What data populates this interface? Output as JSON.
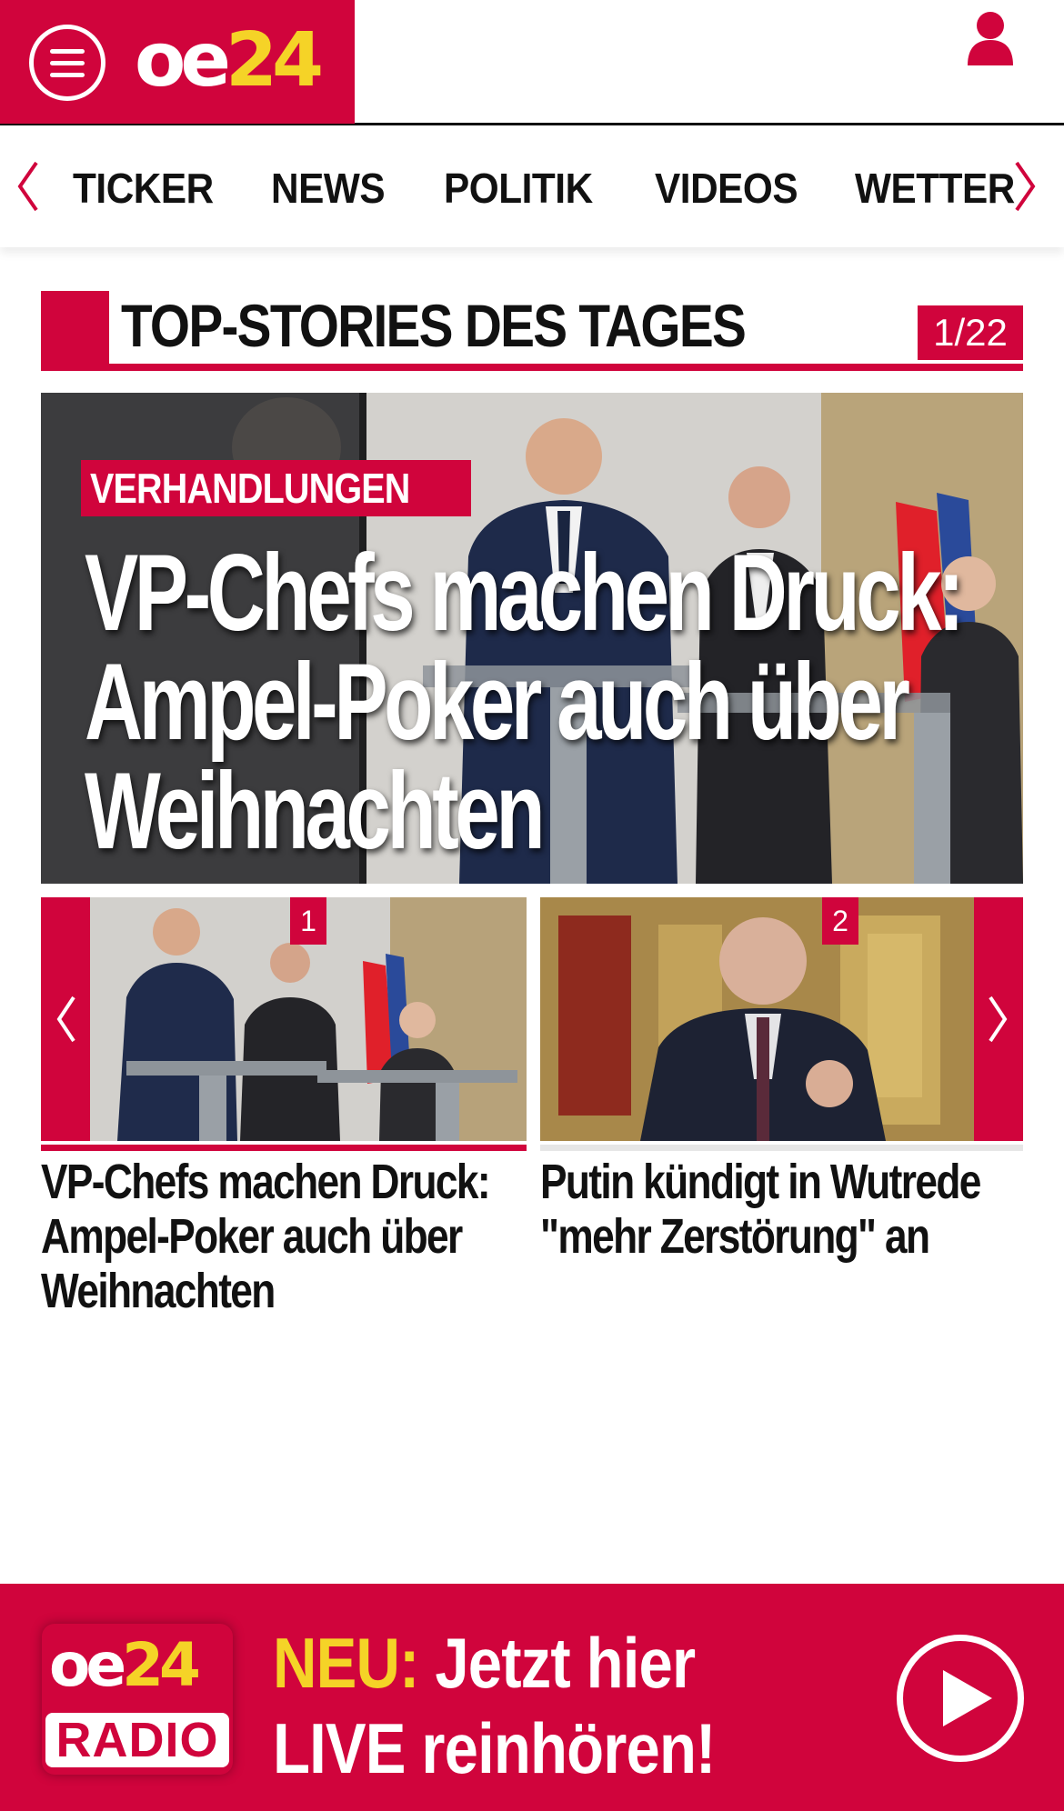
{
  "header": {
    "logo_oe": "oe",
    "logo_num": "24"
  },
  "nav": {
    "items": [
      "TICKER",
      "NEWS",
      "POLITIK",
      "VIDEOS",
      "WETTER"
    ]
  },
  "section": {
    "title": "TOP-STORIES DES TAGES",
    "counter": "1/22"
  },
  "hero": {
    "kicker": "VERHANDLUNGEN",
    "headline": "VP-Chefs machen Druck: Ampel-Poker auch über Weihnachten"
  },
  "carousel": {
    "items": [
      {
        "number": "1",
        "title": "VP-Chefs machen Druck: Ampel-Poker auch über Weihnachten"
      },
      {
        "number": "2",
        "title": "Putin kündigt in Wutrede \"mehr Zerstörung\" an"
      }
    ]
  },
  "radio": {
    "logo_oe": "oe",
    "logo_num": "24",
    "logo_label": "RADIO",
    "line1_prefix": "NEU:",
    "line1_rest": " Jetzt hier",
    "line2": "LIVE reinhören!"
  },
  "colors": {
    "brand_red": "#d0043c",
    "brand_yellow": "#f5d327"
  },
  "icons": [
    "menu-icon",
    "user-icon",
    "chevron-left-icon",
    "chevron-right-icon",
    "play-icon"
  ]
}
